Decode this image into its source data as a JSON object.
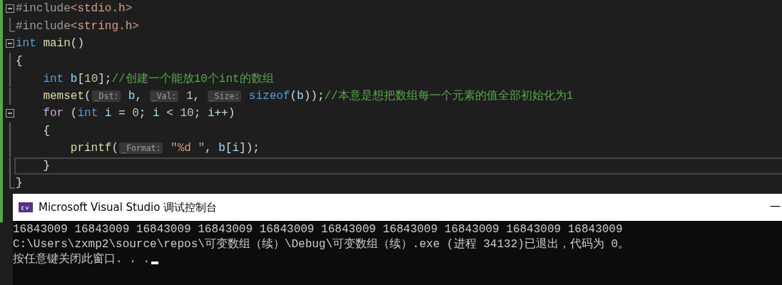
{
  "editor": {
    "lines": [
      {
        "fold_button": true,
        "fold_end": false,
        "current": false,
        "tokens": [
          {
            "kind": "preprocessor",
            "text": "#include"
          },
          {
            "kind": "string",
            "text": "<stdio.h>"
          }
        ]
      },
      {
        "fold_button": false,
        "fold_end": true,
        "current": false,
        "tokens": [
          {
            "kind": "preprocessor",
            "text": "#include"
          },
          {
            "kind": "string",
            "text": "<string.h>"
          }
        ]
      },
      {
        "fold_button": true,
        "fold_end": false,
        "current": false,
        "tokens": [
          {
            "kind": "keyword",
            "text": "int"
          },
          {
            "kind": "function",
            "text": " main"
          },
          {
            "kind": "plain",
            "text": "()"
          }
        ]
      },
      {
        "fold_button": false,
        "fold_end": false,
        "current": false,
        "tokens": [
          {
            "kind": "plain",
            "text": "{"
          }
        ]
      },
      {
        "fold_button": false,
        "fold_end": false,
        "current": false,
        "tokens": [
          {
            "kind": "keyword",
            "text": "    int"
          },
          {
            "kind": "variable",
            "text": " b"
          },
          {
            "kind": "plain",
            "text": "["
          },
          {
            "kind": "number",
            "text": "10"
          },
          {
            "kind": "plain",
            "text": "];"
          },
          {
            "kind": "comment",
            "text": "//创建一个能放10个int的数组"
          }
        ]
      },
      {
        "fold_button": false,
        "fold_end": false,
        "current": false,
        "tokens": [
          {
            "kind": "function",
            "text": "    memset"
          },
          {
            "kind": "plain",
            "text": "("
          },
          {
            "kind": "hint",
            "text": "_Dst:"
          },
          {
            "kind": "variable",
            "text": " b"
          },
          {
            "kind": "plain",
            "text": ", "
          },
          {
            "kind": "hint",
            "text": "_Val:"
          },
          {
            "kind": "number",
            "text": " 1"
          },
          {
            "kind": "plain",
            "text": ", "
          },
          {
            "kind": "hint",
            "text": "_Size:"
          },
          {
            "kind": "keyword",
            "text": " sizeof"
          },
          {
            "kind": "plain",
            "text": "("
          },
          {
            "kind": "variable",
            "text": "b"
          },
          {
            "kind": "plain",
            "text": "));"
          },
          {
            "kind": "comment",
            "text": "//本意是想把数组每一个元素的值全部初始化为1"
          }
        ]
      },
      {
        "fold_button": true,
        "fold_end": false,
        "current": false,
        "tokens": [
          {
            "kind": "control",
            "text": "    for"
          },
          {
            "kind": "plain",
            "text": " ("
          },
          {
            "kind": "keyword",
            "text": "int"
          },
          {
            "kind": "variable",
            "text": " i"
          },
          {
            "kind": "plain",
            "text": " = "
          },
          {
            "kind": "number",
            "text": "0"
          },
          {
            "kind": "plain",
            "text": "; "
          },
          {
            "kind": "variable",
            "text": "i"
          },
          {
            "kind": "plain",
            "text": " < "
          },
          {
            "kind": "number",
            "text": "10"
          },
          {
            "kind": "plain",
            "text": "; "
          },
          {
            "kind": "variable",
            "text": "i"
          },
          {
            "kind": "plain",
            "text": "++)"
          }
        ]
      },
      {
        "fold_button": false,
        "fold_end": false,
        "current": false,
        "tokens": [
          {
            "kind": "plain",
            "text": "    {"
          }
        ]
      },
      {
        "fold_button": false,
        "fold_end": false,
        "current": false,
        "tokens": [
          {
            "kind": "function",
            "text": "        printf"
          },
          {
            "kind": "plain",
            "text": "("
          },
          {
            "kind": "hint",
            "text": "_Format:"
          },
          {
            "kind": "string",
            "text": " \"%d \""
          },
          {
            "kind": "plain",
            "text": ", "
          },
          {
            "kind": "variable",
            "text": "b"
          },
          {
            "kind": "plain",
            "text": "["
          },
          {
            "kind": "variable",
            "text": "i"
          },
          {
            "kind": "plain",
            "text": "]);"
          }
        ]
      },
      {
        "fold_button": false,
        "fold_end": false,
        "current": true,
        "tokens": [
          {
            "kind": "plain",
            "text": "    }"
          }
        ]
      },
      {
        "fold_button": false,
        "fold_end": true,
        "current": false,
        "tokens": [
          {
            "kind": "plain",
            "text": "}"
          }
        ]
      }
    ]
  },
  "console": {
    "title": "Microsoft Visual Studio 调试控制台",
    "minimize": "—",
    "lines": [
      "16843009 16843009 16843009 16843009 16843009 16843009 16843009 16843009 16843009 16843009",
      "C:\\Users\\zxmp2\\source\\repos\\可变数组（续）\\Debug\\可变数组（续）.exe (进程 34132)已退出，代码为 0。",
      "按任意键关闭此窗口. . ."
    ],
    "cursor": true
  }
}
